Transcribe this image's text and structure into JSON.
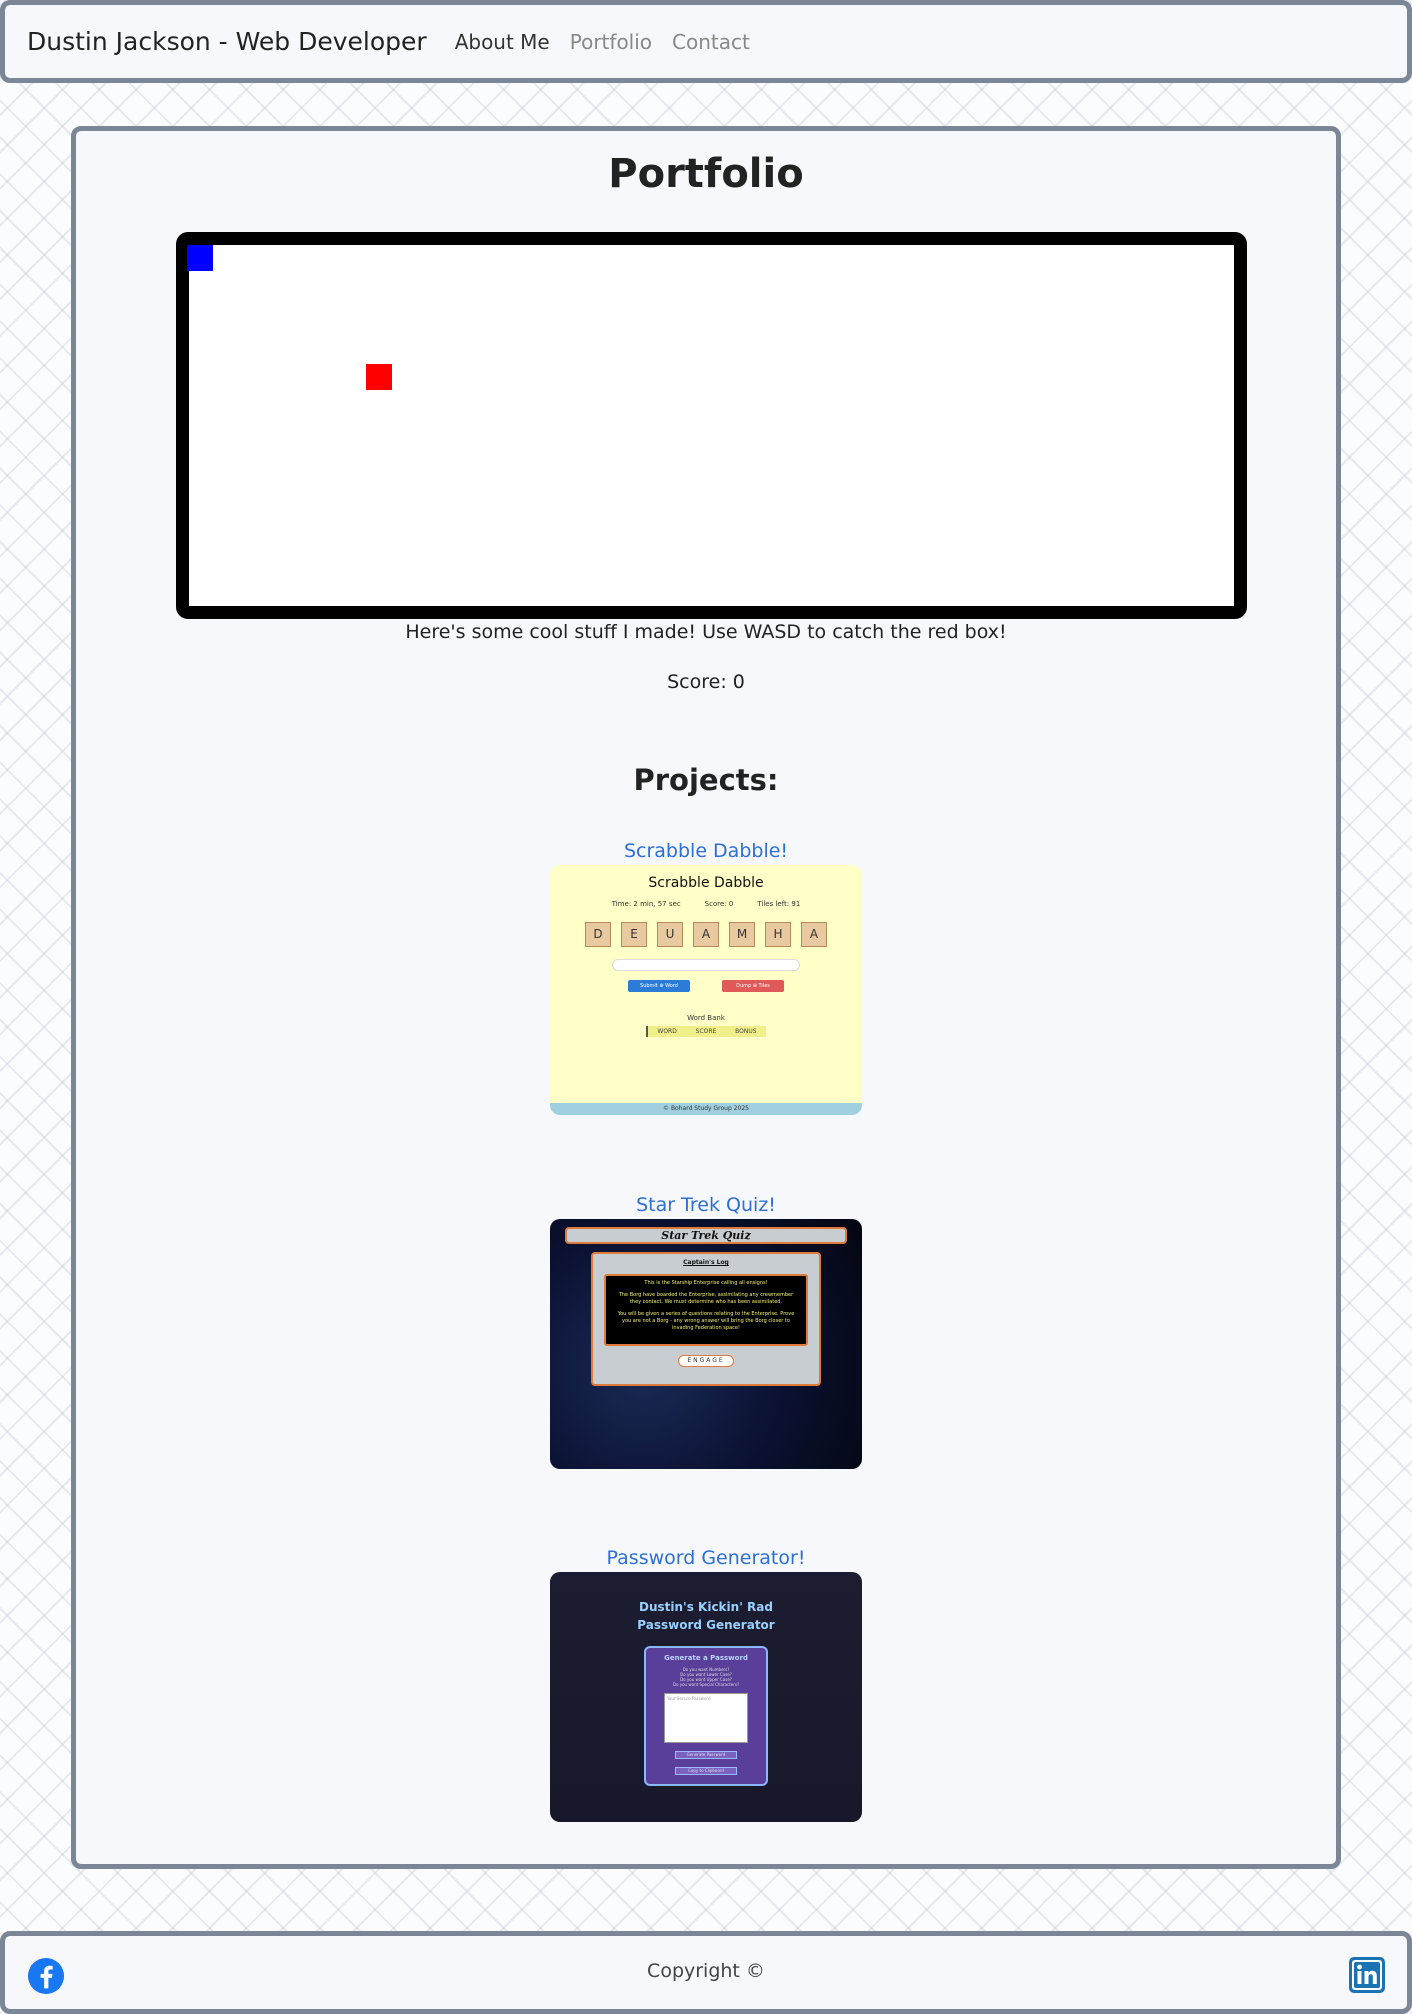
{
  "nav": {
    "brand": "Dustin Jackson - Web Developer",
    "links": [
      "About Me",
      "Portfolio",
      "Contact"
    ]
  },
  "main": {
    "title": "Portfolio",
    "instructions": "Here's some cool stuff I made! Use WASD to catch the red box!",
    "score": "Score: 0",
    "projects_heading": "Projects:",
    "projects": [
      {
        "label": "Scrabble Dabble!",
        "screenshot": {
          "title": "Scrabble Dabble",
          "time": "Time: 2 min, 57 sec",
          "score": "Score: 0",
          "tiles_left": "Tiles left: 91",
          "tiles": [
            "D",
            "E",
            "U",
            "A",
            "M",
            "H",
            "A"
          ],
          "submit": "Submit ⊕ Word",
          "dump": "Dump ⊕ Tiles",
          "word_bank": "Word Bank",
          "bank_cols": [
            "WORD",
            "SCORE",
            "BONUS"
          ],
          "footer": "© Bohard Study Group 2025"
        }
      },
      {
        "label": "Star Trek Quiz!",
        "screenshot": {
          "title": "Star Trek Quiz",
          "log": "Captain's Log",
          "p1": "This is the Starship Enterprise calling all ensigns!",
          "p2": "The Borg have boarded the Enterprise, assimilating any crewmember they contact. We must determine who has been assimilated.",
          "p3": "You will be given a series of questions relating to the Enterprise. Prove you are not a Borg - any wrong answer will bring the Borg closer to invading Federation space!",
          "button": "ENGAGE"
        }
      },
      {
        "label": "Password Generator!",
        "screenshot": {
          "title_line1": "Dustin's Kickin' Rad",
          "title_line2": "Password Generator",
          "subtitle": "Generate a Password",
          "opt1": "Do you want Numbers?",
          "opt2": "Do you want Lower Case?",
          "opt3": "Do you want Upper Case?",
          "opt4": "Do you want Special Characters?",
          "placeholder": "Your Secure Password",
          "btn1": "Generate Password",
          "btn2": "Copy to Clipboard"
        }
      }
    ]
  },
  "footer": {
    "copyright": "Copyright ©"
  },
  "colors": {
    "accent": "#2c6fd6",
    "player": "#0000ff",
    "target": "#ff0000",
    "frame": "#7b8796"
  }
}
